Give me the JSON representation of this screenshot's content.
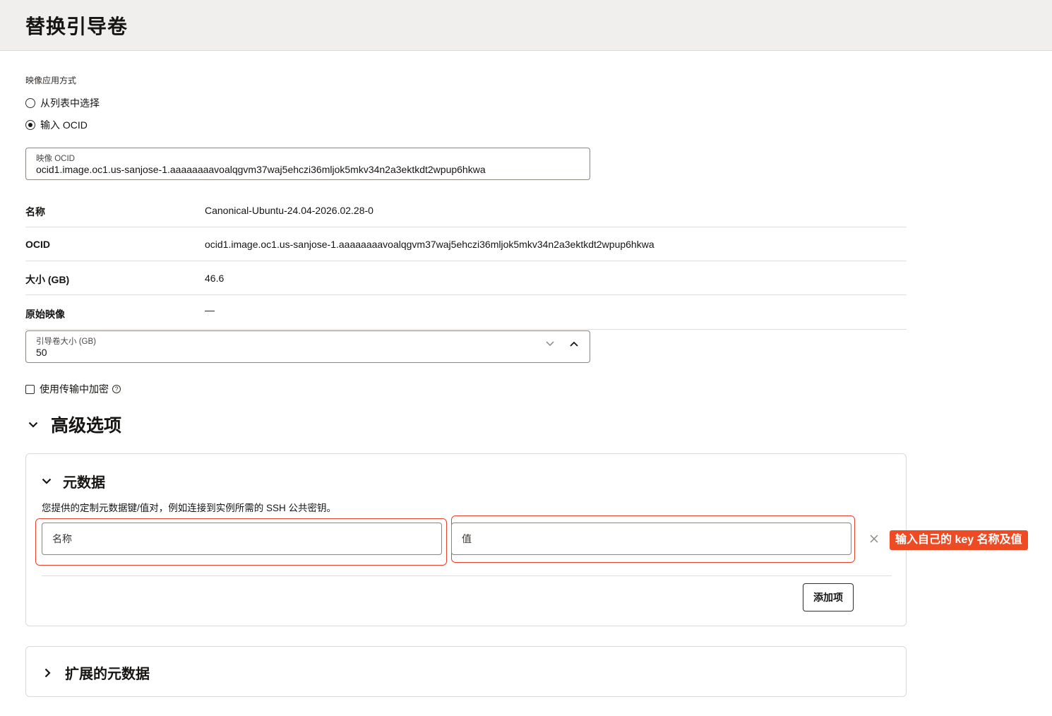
{
  "page": {
    "title": "替换引导卷"
  },
  "image_source": {
    "label": "映像应用方式",
    "options": [
      {
        "label": "从列表中选择",
        "checked": false
      },
      {
        "label": "输入 OCID",
        "checked": true
      }
    ]
  },
  "image_ocid_field": {
    "label": "映像 OCID",
    "value": "ocid1.image.oc1.us-sanjose-1.aaaaaaaavoalqgvm37waj5ehczi36mljok5mkv34n2a3ektkdt2wpup6hkwa"
  },
  "details": [
    {
      "key": "名称",
      "value": "Canonical-Ubuntu-24.04-2026.02.28-0"
    },
    {
      "key": "OCID",
      "value": "ocid1.image.oc1.us-sanjose-1.aaaaaaaavoalqgvm37waj5ehczi36mljok5mkv34n2a3ektkdt2wpup6hkwa"
    },
    {
      "key": "大小 (GB)",
      "value": "46.6"
    },
    {
      "key": "原始映像",
      "value": "—"
    }
  ],
  "boot_volume_size": {
    "label": "引导卷大小 (GB)",
    "value": "50"
  },
  "encryption": {
    "label": "使用传输中加密",
    "checked": false,
    "help_icon": "question-circle-icon"
  },
  "advanced": {
    "title": "高级选项",
    "metadata": {
      "title": "元数据",
      "description": "您提供的定制元数据键/值对，例如连接到实例所需的 SSH 公共密钥。",
      "name_placeholder": "名称",
      "value_placeholder": "值",
      "add_button": "添加项"
    },
    "extended_metadata": {
      "title": "扩展的元数据"
    }
  },
  "annotation": {
    "text": "输入自己的 key 名称及值",
    "color": "#ee4b25"
  },
  "colors": {
    "header_bg": "#f1efed",
    "annotation_border": "#e8422b"
  }
}
